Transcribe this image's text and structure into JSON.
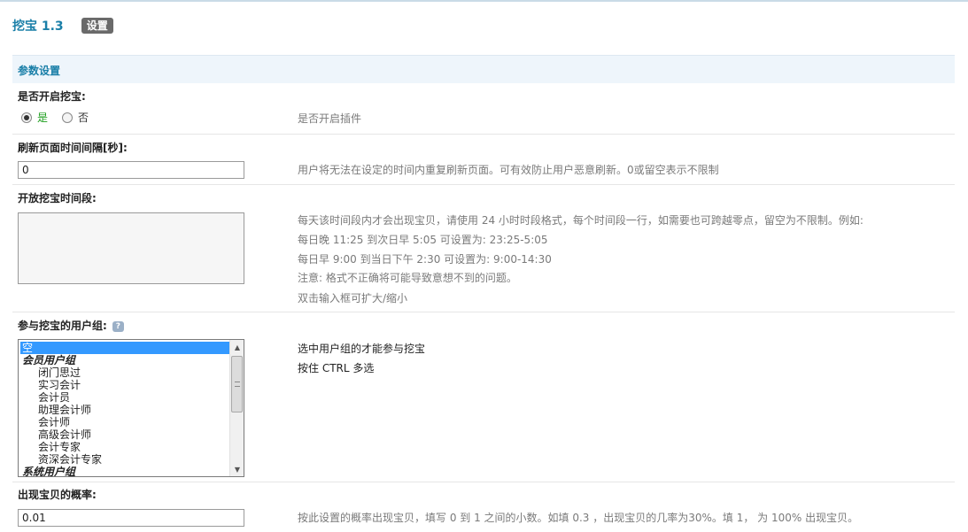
{
  "header": {
    "title": "挖宝 1.3",
    "settings_label": "设置"
  },
  "section": {
    "title": "参数设置"
  },
  "enable": {
    "label": "是否开启挖宝:",
    "option_yes": "是",
    "option_no": "否",
    "selected": "是",
    "hint": "是否开启插件"
  },
  "refresh": {
    "label": "刷新页面时间间隔[秒]:",
    "value": "0",
    "hint": "用户将无法在设定的时间内重复刷新页面。可有效防止用户恶意刷新。0或留空表示不限制"
  },
  "period": {
    "label": "开放挖宝时间段:",
    "value": "",
    "hints": [
      "每天该时间段内才会出现宝贝，请使用 24 小时时段格式，每个时间段一行，如需要也可跨越零点，留空为不限制。例如:",
      "每日晚 11:25 到次日早 5:05 可设置为: 23:25-5:05",
      "每日早 9:00 到当日下午 2:30 可设置为: 9:00-14:30",
      "注意: 格式不正确将可能导致意想不到的问题。",
      "双击输入框可扩大/缩小"
    ]
  },
  "groups": {
    "label": "参与挖宝的用户组:",
    "help_icon": "?",
    "options": [
      {
        "label": "空",
        "type": "selected"
      },
      {
        "label": "会员用户组",
        "type": "group"
      },
      {
        "label": "闭门思过",
        "type": "child"
      },
      {
        "label": "实习会计",
        "type": "child"
      },
      {
        "label": "会计员",
        "type": "child"
      },
      {
        "label": "助理会计师",
        "type": "child"
      },
      {
        "label": "会计师",
        "type": "child"
      },
      {
        "label": "高级会计师",
        "type": "child"
      },
      {
        "label": "会计专家",
        "type": "child"
      },
      {
        "label": "资深会计专家",
        "type": "child"
      },
      {
        "label": "系统用户组",
        "type": "group"
      }
    ],
    "hints": [
      "选中用户组的才能参与挖宝",
      "按住 CTRL 多选"
    ]
  },
  "probability": {
    "label": "出现宝贝的概率:",
    "value": "0.01",
    "hint": "按此设置的概率出现宝贝，填写 0 到 1 之间的小数。如填 0.3 ，出现宝贝的几率为30%。填 1， 为 100% 出现宝贝。"
  }
}
